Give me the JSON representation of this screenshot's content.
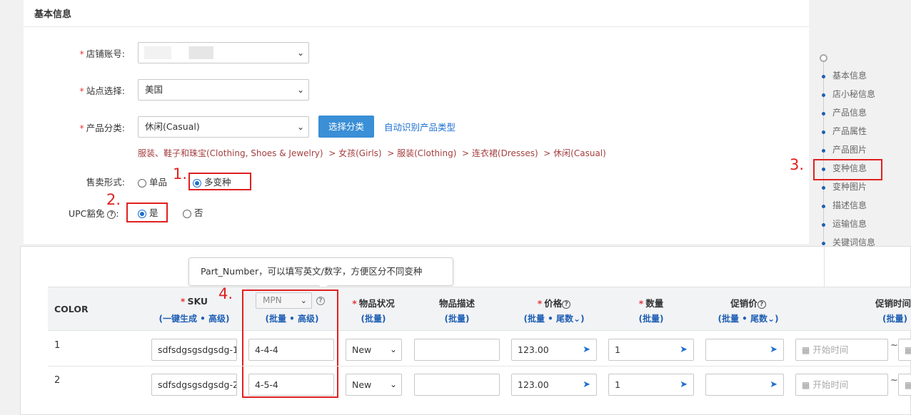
{
  "basic_info": {
    "title": "基本信息",
    "store_label": "店铺账号:",
    "store_value": "",
    "site_label": "站点选择:",
    "site_value": "美国",
    "category_label": "产品分类:",
    "category_value": "休闲(Casual)",
    "choose_category_btn": "选择分类",
    "auto_detect_link": "自动识别产品类型",
    "breadcrumb": "服装、鞋子和珠宝(Clothing, Shoes & Jewelry)  > 女孩(Girls)  > 服装(Clothing)  > 连衣裙(Dresses)  > 休闲(Casual)",
    "sale_label": "售卖形式:",
    "sale_single": "单品",
    "sale_multi": "多变种",
    "upc_label": "UPC豁免",
    "upc_yes": "是",
    "upc_no": "否",
    "required_mark": "*"
  },
  "annotations": {
    "a1": "1.",
    "a2": "2.",
    "a3": "3.",
    "a4": "4."
  },
  "side_nav": {
    "items": [
      "基本信息",
      "店小秘信息",
      "产品信息",
      "产品属性",
      "产品图片",
      "变种信息",
      "变种图片",
      "描述信息",
      "运输信息",
      "关键词信息"
    ],
    "active": "变种信息"
  },
  "tooltip": "Part_Number，可以填写英文/数字，方便区分不同变种",
  "variant_table": {
    "headers": {
      "color": "COLOR",
      "sku": "SKU",
      "sku_sub_a": "一键生成",
      "sku_sub_b": "高级",
      "mpn": "MPN",
      "mpn_sub_a": "批量",
      "mpn_sub_b": "高级",
      "condition": "物品状况",
      "condition_sub": "批量",
      "desc": "物品描述",
      "desc_sub": "批量",
      "price": "价格",
      "price_sub_a": "批量",
      "price_sub_b": "尾数",
      "qty": "数量",
      "qty_sub": "批量",
      "promo": "促销价",
      "promo_sub_a": "批量",
      "promo_sub_b": "尾数",
      "promo_time": "促销时间",
      "promo_time_sub": "批量"
    },
    "rows": [
      {
        "color": "1",
        "sku": "sdfsdgsgsdgsdg-1",
        "mpn": "4-4-4",
        "condition": "New",
        "desc": "",
        "price": "123.00",
        "qty": "1",
        "promo": "",
        "start_placeholder": "开始时间"
      },
      {
        "color": "2",
        "sku": "sdfsdgsgsdgsdg-2",
        "mpn": "4-5-4",
        "condition": "New",
        "desc": "",
        "price": "123.00",
        "qty": "1",
        "promo": "",
        "start_placeholder": "开始时间"
      }
    ],
    "range_sep": "~"
  },
  "colors": {
    "accent": "#3a8fd6",
    "link": "#1e6fd0",
    "annotation": "#e02020",
    "breadcrumb": "#a43f3f"
  }
}
